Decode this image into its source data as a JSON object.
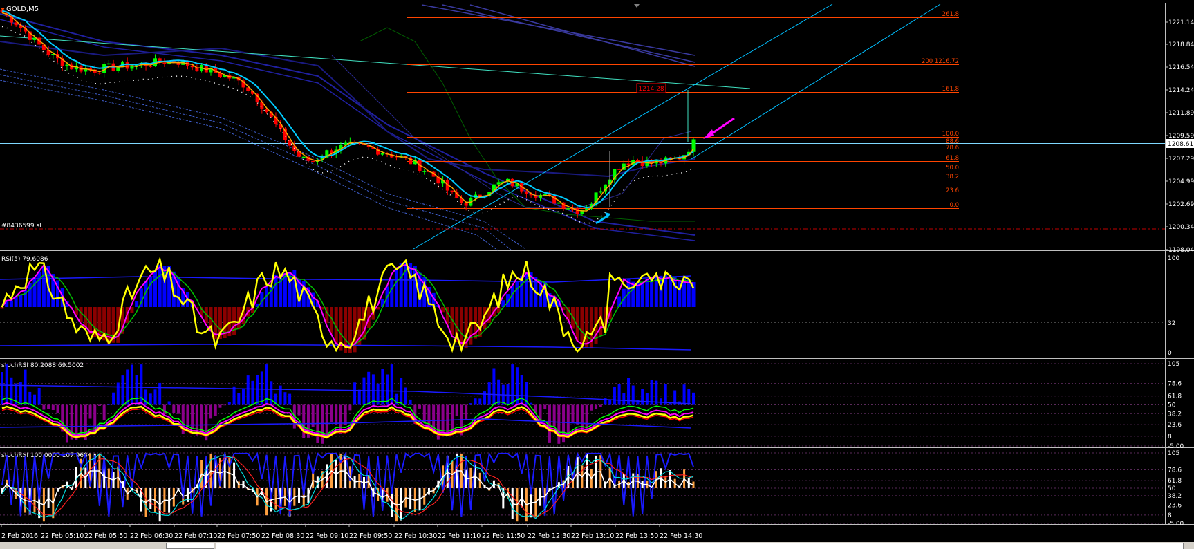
{
  "window": {
    "symbol_label": "GOLD,M5"
  },
  "main_panel": {
    "price_ticks": [
      "1221.14",
      "1218.84",
      "1216.54",
      "1214.24",
      "1211.89",
      "1209.59",
      "1207.29",
      "1204.99",
      "1202.69",
      "1200.34",
      "1198.04"
    ],
    "current_price": "1208.61",
    "order_label": "#8436599 sl",
    "target_box": "1214.28",
    "fib_levels": [
      {
        "label": "261.8"
      },
      {
        "label": "200 1216.72"
      },
      {
        "label": "161.8"
      },
      {
        "label": "100.0"
      },
      {
        "label": "88.6"
      },
      {
        "label": "78.6"
      },
      {
        "label": "61.8"
      },
      {
        "label": "50.0"
      },
      {
        "label": "38.2"
      },
      {
        "label": "23.6"
      },
      {
        "label": "0.0"
      }
    ]
  },
  "rsi_panel": {
    "title": "RSI(5) 79.6086",
    "ticks": [
      "100",
      "32",
      "0"
    ]
  },
  "stoch_panel_1": {
    "title": "stochRSI 80.2088 69.5002",
    "ticks": [
      "105",
      "78.6",
      "61.8",
      "50",
      "38.2",
      "23.6",
      "8",
      "-5.00"
    ]
  },
  "stoch_panel_2": {
    "title": "stochRSI 100.0000 107.9684",
    "ticks": [
      "105",
      "78.6",
      "61.8",
      "50",
      "38.2",
      "23.6",
      "8",
      "-5.00"
    ]
  },
  "time_axis": [
    "2 Feb 2016",
    "22 Feb 05:10",
    "22 Feb 05:50",
    "22 Feb 06:30",
    "22 Feb 07:10",
    "22 Feb 07:50",
    "22 Feb 08:30",
    "22 Feb 09:10",
    "22 Feb 09:50",
    "22 Feb 10:30",
    "22 Feb 11:10",
    "22 Feb 11:50",
    "22 Feb 12:30",
    "22 Feb 13:10",
    "22 Feb 13:50",
    "22 Feb 14:30"
  ],
  "colors": {
    "background": "#000000",
    "bull_candle": "#00ff00",
    "bear_candle": "#ff0000",
    "fib": "#ff4500",
    "rsi_line": "#ffff00",
    "histogram_up": "#0000ff",
    "histogram_down": "#8b0000",
    "stoch_histogram_down": "#8b008b",
    "channel": "#00bfff",
    "arrow_magenta": "#ff00ff",
    "arrow_cyan": "#00bfff"
  },
  "chart_data": {
    "type": "candlestick",
    "symbol": "GOLD",
    "timeframe": "M5",
    "time_labels": [
      "22 Feb 05:10",
      "22 Feb 05:50",
      "22 Feb 06:30",
      "22 Feb 07:10",
      "22 Feb 07:50",
      "22 Feb 08:30",
      "22 Feb 09:10",
      "22 Feb 09:50",
      "22 Feb 10:30",
      "22 Feb 11:10",
      "22 Feb 11:50",
      "22 Feb 12:30",
      "22 Feb 13:10",
      "22 Feb 13:50",
      "22 Feb 14:30"
    ],
    "close_path": [
      1222.1,
      1221.3,
      1220.2,
      1219.0,
      1218.0,
      1217.2,
      1216.6,
      1216.4,
      1216.3,
      1216.5,
      1216.6,
      1216.7,
      1216.8,
      1217.0,
      1217.1,
      1217.2,
      1216.9,
      1216.5,
      1216.2,
      1215.8,
      1215.4,
      1214.8,
      1213.6,
      1212.0,
      1210.2,
      1208.6,
      1207.2,
      1207.0,
      1207.8,
      1208.4,
      1208.6,
      1208.5,
      1208.3,
      1208.0,
      1207.6,
      1207.2,
      1206.6,
      1205.9,
      1205.0,
      1203.6,
      1202.7,
      1203.2,
      1204.0,
      1204.7,
      1204.9,
      1204.3,
      1203.9,
      1203.4,
      1203.0,
      1202.5,
      1202.0,
      1202.6,
      1204.4,
      1206.0,
      1206.9,
      1207.2,
      1206.8,
      1206.9,
      1207.1,
      1207.5,
      1208.9
    ],
    "price_range": [
      1198.04,
      1222.2
    ],
    "rsi_value": 79.6086,
    "stochrsi_1": [
      80.2088,
      69.5002
    ],
    "stochrsi_2": [
      100.0,
      107.9684
    ]
  }
}
